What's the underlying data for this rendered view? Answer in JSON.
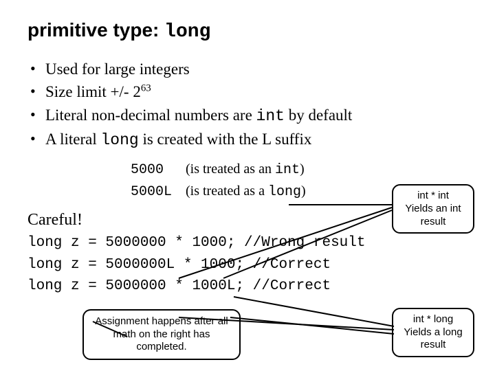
{
  "title": {
    "prefix": "primitive type: ",
    "typename": "long"
  },
  "bullets": {
    "b1": "Used for large integers",
    "b2": {
      "pre": "Size limit +/- 2",
      "sup": "63"
    },
    "b3": {
      "pre": "Literal non-decimal numbers are ",
      "code": "int",
      "post": " by default"
    },
    "b4": {
      "pre": "A literal ",
      "code": "long",
      "post": " is created with the L suffix"
    }
  },
  "examples": {
    "r1": {
      "code": "5000",
      "text_pre": "(is treated as an ",
      "text_code": "int",
      "text_post": ")"
    },
    "r2": {
      "code": "5000L",
      "text_pre": "(is treated as a ",
      "text_code": "long",
      "text_post": ")"
    }
  },
  "careful": "Careful!",
  "codeblock": {
    "l1": "long z = 5000000 * 1000; //Wrong result",
    "l2": "long z = 5000000L * 1000; //Correct",
    "l3": "long z = 5000000 * 1000L; //Correct"
  },
  "callouts": {
    "c1": {
      "l1": "int * int",
      "l2": "Yields an int",
      "l3": "result"
    },
    "c2": {
      "l1": "int * long",
      "l2": "Yields a long",
      "l3": "result"
    },
    "c3": {
      "l1": "Assignment happens after all",
      "l2": "math on the right has completed."
    }
  }
}
